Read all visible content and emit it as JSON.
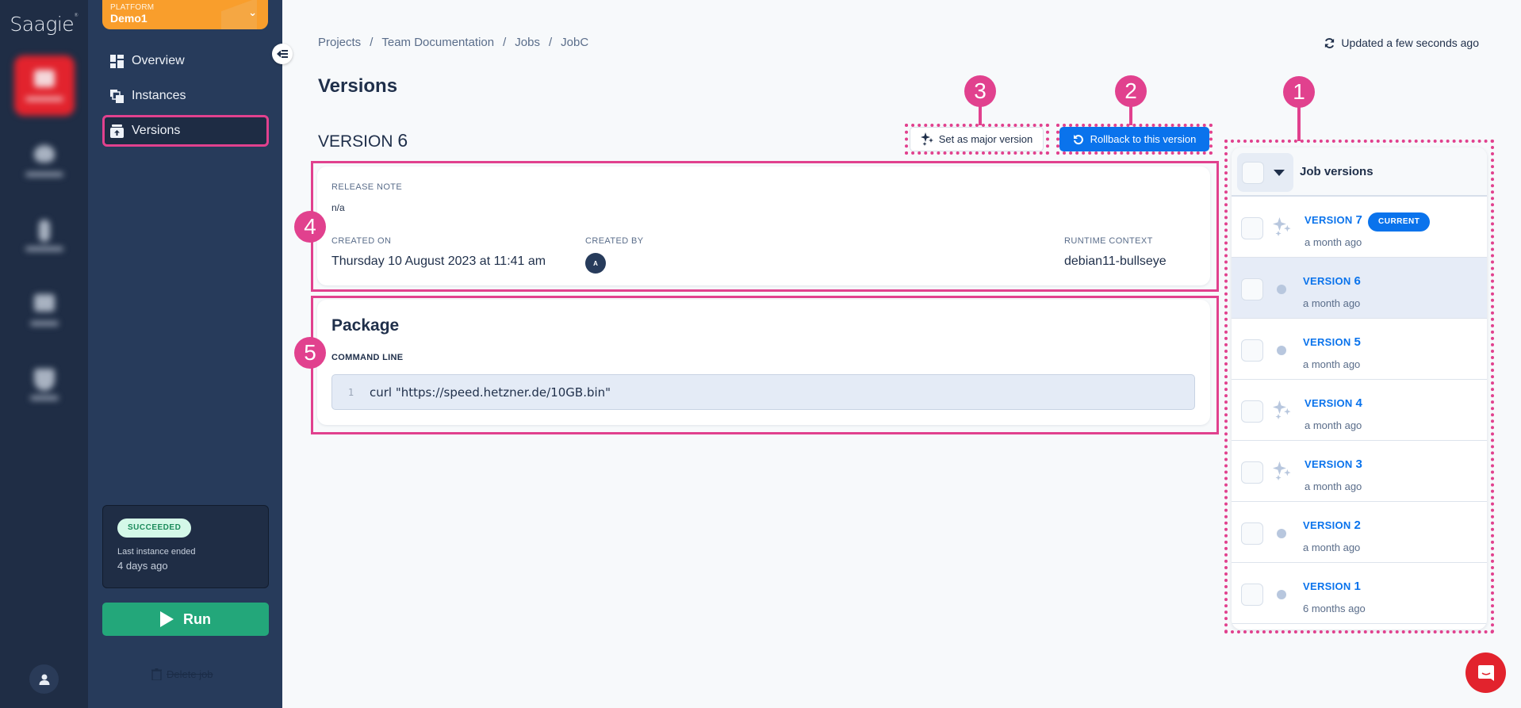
{
  "app": {
    "logo": "Saagie"
  },
  "platform": {
    "label": "PLATFORM",
    "name": "Demo1"
  },
  "sidebar": {
    "items": [
      {
        "label": "Overview",
        "icon": "dashboard-icon"
      },
      {
        "label": "Instances",
        "icon": "stacked-squares-icon"
      },
      {
        "label": "Versions",
        "icon": "upload-box-icon",
        "selected": true
      }
    ],
    "status": {
      "badge": "SUCCEEDED",
      "line1": "Last instance ended",
      "line2": "4 days ago"
    },
    "run_label": "Run",
    "delete_label": "Delete job"
  },
  "header": {
    "breadcrumb": [
      "Projects",
      "Team Documentation",
      "Jobs",
      "JobC"
    ],
    "breadcrumb_sep": "/",
    "updated": "Updated a few seconds ago",
    "title": "Versions"
  },
  "version_detail": {
    "heading_prefix": "VERSION",
    "heading_number": "6",
    "set_major_label": "Set as major version",
    "rollback_label": "Rollback to this version",
    "release_note_label": "RELEASE NOTE",
    "release_note": "n/a",
    "created_on_label": "CREATED ON",
    "created_on": "Thursday 10 August 2023 at 11:41 am",
    "created_by_label": "CREATED BY",
    "created_by_initial": "A",
    "runtime_label": "RUNTIME CONTEXT",
    "runtime": "debian11-bullseye"
  },
  "package": {
    "title": "Package",
    "command_label": "COMMAND LINE",
    "lines": [
      {
        "number": "1",
        "code": "curl \"https://speed.hetzner.de/10GB.bin\""
      }
    ]
  },
  "versions_panel": {
    "title": "Job versions",
    "items": [
      {
        "prefix": "VERSION",
        "number": "7",
        "time": "a month ago",
        "major": true,
        "badge": "CURRENT",
        "selected": false
      },
      {
        "prefix": "VERSION",
        "number": "6",
        "time": "a month ago",
        "major": false,
        "selected": true
      },
      {
        "prefix": "VERSION",
        "number": "5",
        "time": "a month ago",
        "major": false,
        "selected": false
      },
      {
        "prefix": "VERSION",
        "number": "4",
        "time": "a month ago",
        "major": true,
        "selected": false
      },
      {
        "prefix": "VERSION",
        "number": "3",
        "time": "a month ago",
        "major": true,
        "selected": false
      },
      {
        "prefix": "VERSION",
        "number": "2",
        "time": "a month ago",
        "major": false,
        "selected": false
      },
      {
        "prefix": "VERSION",
        "number": "1",
        "time": "6 months ago",
        "major": false,
        "selected": false
      }
    ]
  },
  "annotations": [
    "1",
    "2",
    "3",
    "4",
    "5"
  ],
  "colors": {
    "accent_blue": "#0a73ec",
    "annotation_pink": "#e1418e",
    "success_green": "#23a77a",
    "platform_orange": "#f99e2c",
    "brand_red": "#e2232d"
  }
}
